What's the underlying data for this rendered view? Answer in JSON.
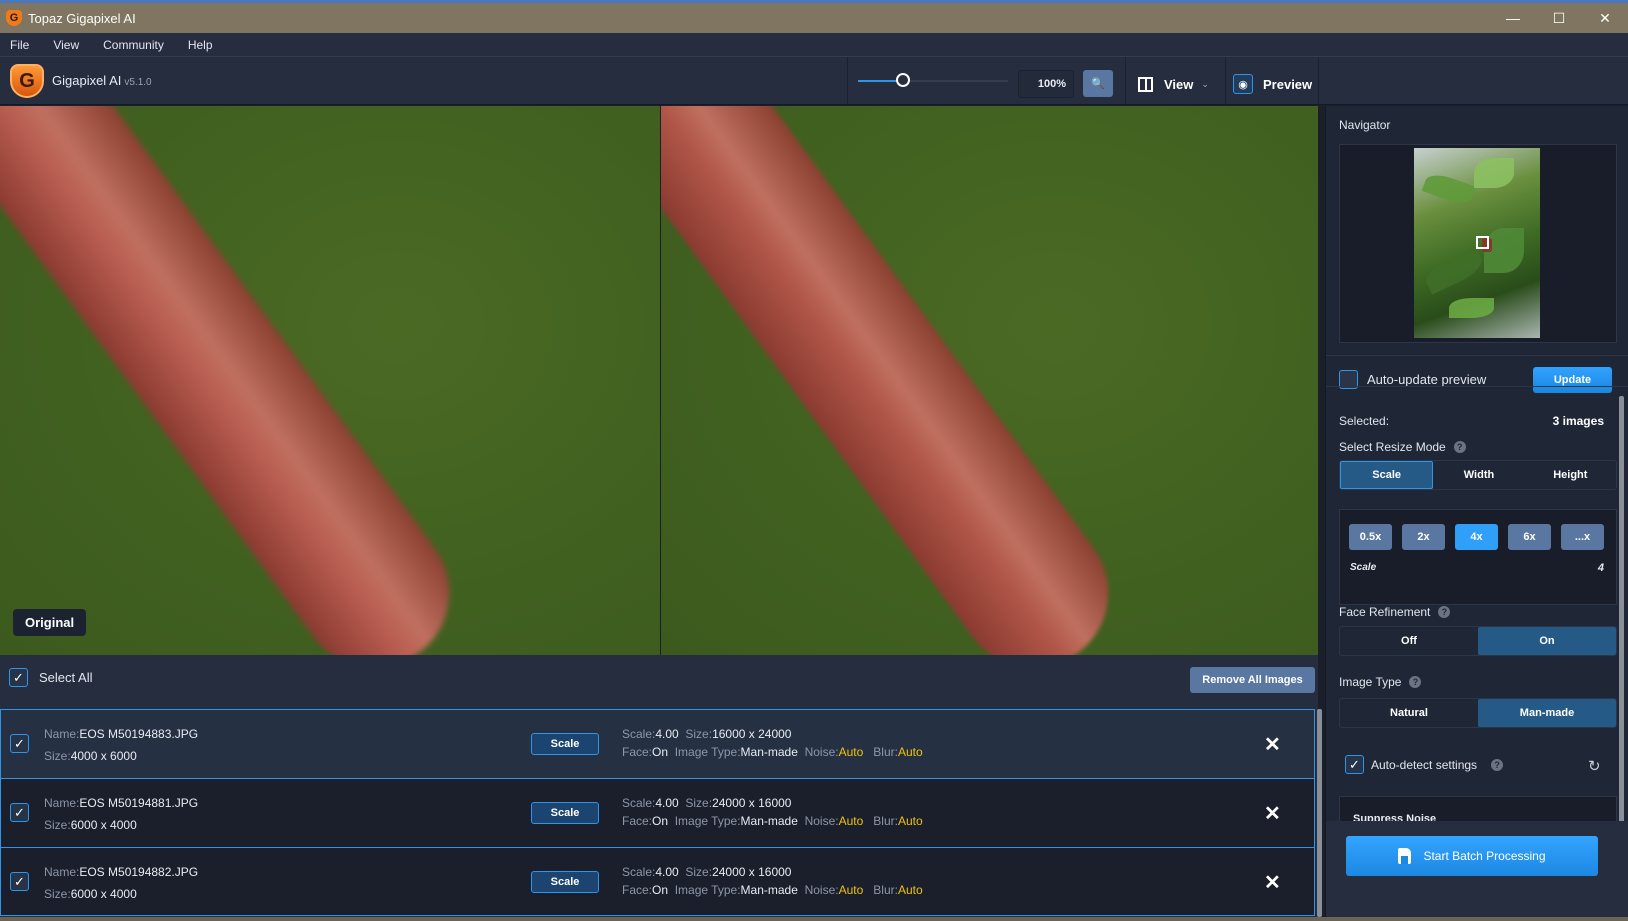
{
  "window": {
    "title": "Topaz Gigapixel AI",
    "controls": {
      "minimize": "—",
      "maximize": "☐",
      "close": "✕"
    }
  },
  "menu": [
    "File",
    "View",
    "Community",
    "Help"
  ],
  "toolbar": {
    "app_name": "Gigapixel AI",
    "version": "v5.1.0",
    "zoom_level_percent": 30,
    "zoom_value": "100%",
    "zoom_button_icon": "zoom-in-icon",
    "view_label": "View",
    "preview_label": "Preview",
    "accent_color": "#2f95e8"
  },
  "viewer": {
    "original_label": "Original"
  },
  "list": {
    "select_all_label": "Select All",
    "select_all_checked": true,
    "remove_all_label": "Remove All Images",
    "labels": {
      "name": "Name:",
      "size": "Size:",
      "scale": "Scale:",
      "face": "Face:",
      "image_type": "Image Type:",
      "noise": "Noise:",
      "blur": "Blur:"
    },
    "scale_button": "Scale",
    "items": [
      {
        "checked": true,
        "name": "EOS M50194883.JPG",
        "size": "4000 x 6000",
        "scale": "4.00",
        "out_size": "16000 x 24000",
        "face": "On",
        "image_type": "Man-made",
        "noise": "Auto",
        "blur": "Auto"
      },
      {
        "checked": true,
        "name": "EOS M50194881.JPG",
        "size": "6000 x 4000",
        "scale": "4.00",
        "out_size": "24000 x 16000",
        "face": "On",
        "image_type": "Man-made",
        "noise": "Auto",
        "blur": "Auto"
      },
      {
        "checked": true,
        "name": "EOS M50194882.JPG",
        "size": "6000 x 4000",
        "scale": "4.00",
        "out_size": "24000 x 16000",
        "face": "On",
        "image_type": "Man-made",
        "noise": "Auto",
        "blur": "Auto"
      }
    ]
  },
  "sidebar": {
    "navigator_title": "Navigator",
    "auto_update_label": "Auto-update preview",
    "auto_update_checked": false,
    "update_label": "Update",
    "selected_label": "Selected:",
    "selected_value": "3 images",
    "resize_mode_label": "Select Resize Mode",
    "resize_modes": [
      "Scale",
      "Width",
      "Height"
    ],
    "resize_mode_active": "Scale",
    "scale_presets": [
      "0.5x",
      "2x",
      "4x",
      "6x",
      "...x"
    ],
    "scale_preset_active": "4x",
    "scale_label": "Scale",
    "scale_value": "4",
    "face_refinement_label": "Face Refinement",
    "face_options": [
      "Off",
      "On"
    ],
    "face_active": "On",
    "image_type_label": "Image Type",
    "image_type_options": [
      "Natural",
      "Man-made"
    ],
    "image_type_active": "Man-made",
    "autodetect_label": "Auto-detect settings",
    "autodetect_checked": true,
    "suppress_noise_label": "Suppress Noise",
    "batch_label": "Start Batch Processing"
  }
}
